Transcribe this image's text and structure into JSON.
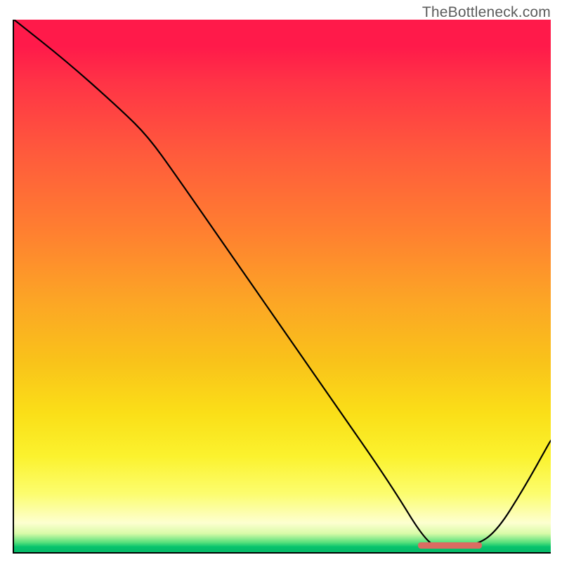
{
  "attribution": "TheBottleneck.com",
  "chart_data": {
    "type": "line",
    "title": "",
    "xlabel": "",
    "ylabel": "",
    "xlim": [
      0,
      100
    ],
    "ylim": [
      0,
      100
    ],
    "series": [
      {
        "name": "bottleneck-curve",
        "x": [
          0,
          10,
          20,
          25,
          30,
          40,
          50,
          60,
          70,
          77,
          80,
          86,
          90,
          95,
          100
        ],
        "values": [
          100,
          92,
          83,
          78,
          71,
          56.5,
          42,
          27.5,
          13,
          1.5,
          1,
          1.2,
          4,
          12,
          21
        ]
      }
    ],
    "optimal_range": {
      "start": 75,
      "end": 87
    },
    "legend": false,
    "grid": false
  },
  "colors": {
    "top": "#ff1a4a",
    "mid": "#fadf18",
    "bottom": "#06b868",
    "curve": "#000000",
    "marker": "#db6c62",
    "attribution_text": "#5c5c5c"
  }
}
